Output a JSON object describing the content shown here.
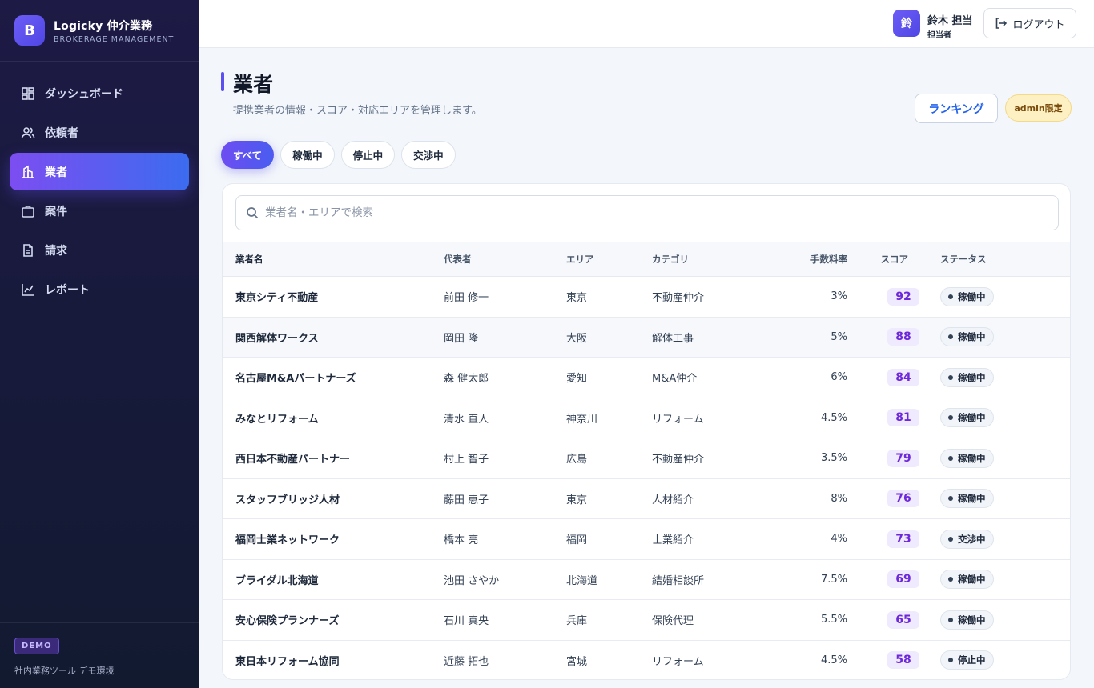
{
  "app": {
    "logo_letter": "B",
    "title": "Logicky 仲介業務",
    "subtitle": "BROKERAGE MANAGEMENT"
  },
  "sidebar": {
    "items": [
      {
        "label": "ダッシュボード",
        "icon": "dashboard-icon"
      },
      {
        "label": "依頼者",
        "icon": "users-icon"
      },
      {
        "label": "業者",
        "icon": "building-icon",
        "active": true
      },
      {
        "label": "案件",
        "icon": "briefcase-icon"
      },
      {
        "label": "請求",
        "icon": "invoice-icon"
      },
      {
        "label": "レポート",
        "icon": "chart-icon"
      }
    ],
    "demo_badge": "DEMO",
    "demo_text": "社内業務ツール デモ環境"
  },
  "header": {
    "avatar_letter": "鈴",
    "user_name": "鈴木 担当",
    "user_role": "担当者",
    "logout_label": "ログアウト"
  },
  "page": {
    "title": "業者",
    "description": "提携業者の情報・スコア・対応エリアを管理します。",
    "ranking_label": "ランキング",
    "admin_badge": "admin限定"
  },
  "filters": [
    "すべて",
    "稼働中",
    "停止中",
    "交渉中"
  ],
  "search": {
    "placeholder": "業者名・エリアで検索",
    "value": ""
  },
  "table": {
    "columns": [
      "業者名",
      "代表者",
      "エリア",
      "カテゴリ",
      "手数料率",
      "スコア",
      "ステータス"
    ],
    "rows": [
      [
        "東京シティ不動産",
        "前田 修一",
        "東京",
        "不動産仲介",
        "3%",
        "92",
        "稼働中"
      ],
      [
        "関西解体ワークス",
        "岡田 隆",
        "大阪",
        "解体工事",
        "5%",
        "88",
        "稼働中"
      ],
      [
        "名古屋M&Aパートナーズ",
        "森 健太郎",
        "愛知",
        "M&A仲介",
        "6%",
        "84",
        "稼働中"
      ],
      [
        "みなとリフォーム",
        "清水 直人",
        "神奈川",
        "リフォーム",
        "4.5%",
        "81",
        "稼働中"
      ],
      [
        "西日本不動産パートナー",
        "村上 智子",
        "広島",
        "不動産仲介",
        "3.5%",
        "79",
        "稼働中"
      ],
      [
        "スタッフブリッジ人材",
        "藤田 恵子",
        "東京",
        "人材紹介",
        "8%",
        "76",
        "稼働中"
      ],
      [
        "福岡士業ネットワーク",
        "橋本 亮",
        "福岡",
        "士業紹介",
        "4%",
        "73",
        "交渉中"
      ],
      [
        "ブライダル北海道",
        "池田 さやか",
        "北海道",
        "結婚相談所",
        "7.5%",
        "69",
        "稼働中"
      ],
      [
        "安心保険プランナーズ",
        "石川 真央",
        "兵庫",
        "保険代理",
        "5.5%",
        "65",
        "稼働中"
      ],
      [
        "東日本リフォーム協同",
        "近藤 拓也",
        "宮城",
        "リフォーム",
        "4.5%",
        "58",
        "停止中"
      ]
    ]
  },
  "colors": {
    "accent": "#5b4ff0",
    "score_text": "#6d28d9",
    "sidebar_bg": "#1d1a45"
  }
}
